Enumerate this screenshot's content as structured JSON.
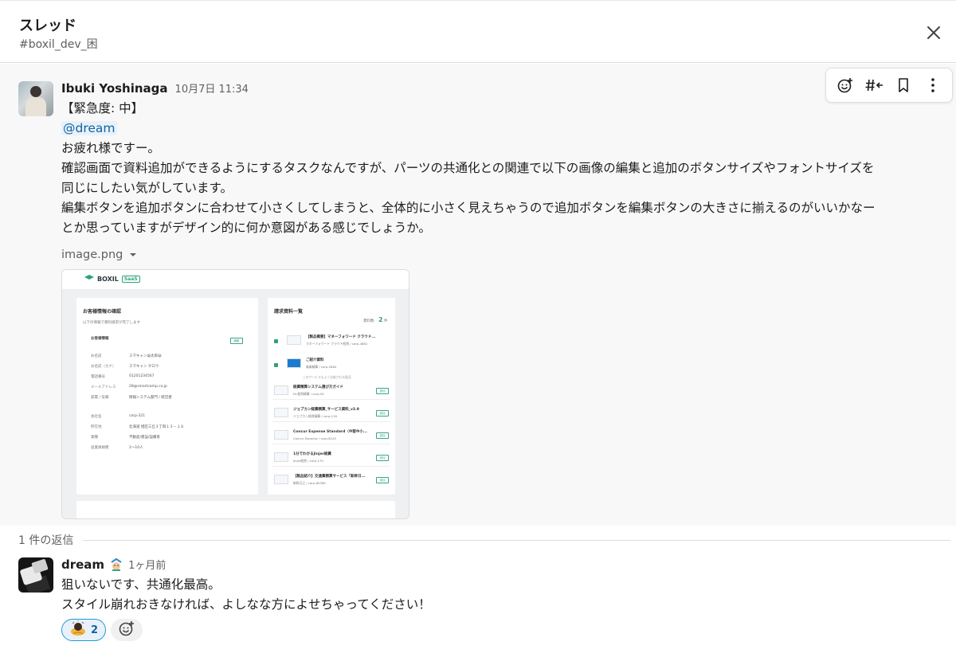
{
  "header": {
    "title": "スレッド",
    "channel": "#boxil_dev_困"
  },
  "parent_message": {
    "author": "Ibuki Yoshinaga",
    "timestamp": "10月7日 11:34",
    "lines": [
      "【緊急度: 中】",
      "@dream",
      "お疲れ様ですー。",
      "確認画面で資料追加ができるようにするタスクなんですが、パーツの共通化との関連で以下の画像の編集と追加のボタンサイズやフォントサイズを",
      "同じにしたい気がしています。",
      "編集ボタンを追加ボタンに合わせて小さくしてしまうと、全体的に小さく見えちゃうので追加ボタンを編集ボタンの大きさに揃えるのがいいかなー",
      "とか思っていますがデザイン的に何か意図がある感じでしょうか。"
    ],
    "file_name": "image.png",
    "toolbar": [
      "add-reaction",
      "reply-in-channel",
      "bookmark",
      "more-actions"
    ]
  },
  "attachment_preview": {
    "logo": "BOXIL",
    "logo_badge": "SaaS",
    "left_title": "お客様情報の確認",
    "left_subtitle": "以下の情報で資料請求が完了します",
    "section_title": "お客様情報",
    "edit_label": "編集",
    "fields": [
      {
        "label": "お名前",
        "value": "スマキャン😀太郎😀"
      },
      {
        "label": "お名前（カナ）",
        "value": "スマキャン タロウ"
      },
      {
        "label": "電話番号",
        "value": "01201234567"
      },
      {
        "label": "メールアドレス",
        "value": "28@smartcamp.co.jp"
      },
      {
        "label": "部署 / 役職",
        "value": "情報システム部門 / 経営者"
      },
      {
        "label": "会社名",
        "value": "corp-321"
      },
      {
        "label": "所在地",
        "value": "北海道 旭区三丘３丁目１３－１８"
      },
      {
        "label": "業種",
        "value": "不動産/建設/設備系"
      },
      {
        "label": "従業員規模",
        "value": "2〜10人"
      }
    ],
    "right_title": "請求資料一覧",
    "count_label": "資料数",
    "count_value": "2",
    "count_unit": "件",
    "divider_text": "このサービスもよく比較される製品",
    "add_label": "追加",
    "docs": [
      {
        "name": "【製品概要】マネーフォワード クラウド...",
        "sub": "マネーフォワード クラウド経費 / corp-4682"
      },
      {
        "name": "ご紹介資料",
        "sub": "楽楽精算 / corp-2684"
      },
      {
        "name": "経費精算システム選び方ガイド",
        "sub": "Dr.経費精算 / corp-92"
      },
      {
        "name": "ジョブカン経費精算_サービス資料_v3.9",
        "sub": "ジョブカン経費精算 / corp-116"
      },
      {
        "name": "Concur Expense Standard（中堅中小...",
        "sub": "Concur Expense / corp-8140"
      },
      {
        "name": "1分でわかるJinjer経費",
        "sub": "jinjer経費 / corp-170"
      },
      {
        "name": "【製品紹介】交通費精算サービス「新幹日...",
        "sub": "新幹日之 / corp-80389"
      }
    ]
  },
  "replies": {
    "count_label": "1 件の返信",
    "items": [
      {
        "author": "dream",
        "timestamp": "1ヶ月前",
        "lines": [
          "狙いないです、共通化最高。",
          "スタイル崩れおきなければ、よしなな方によせちゃってください！"
        ],
        "reactions": [
          {
            "emoji": "bow-emoji",
            "count": "2"
          }
        ]
      }
    ]
  },
  "colors": {
    "mention_bg": "#e8f1fa",
    "link": "#1264a3",
    "reaction_border": "#1d9bd1",
    "brand_green": "#2fa27a"
  }
}
